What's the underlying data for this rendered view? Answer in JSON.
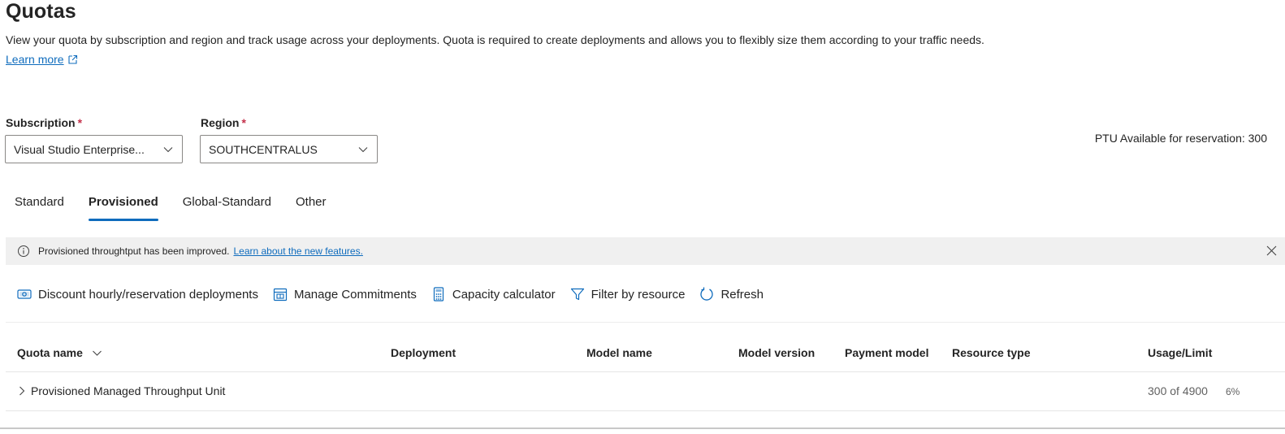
{
  "page": {
    "title": "Quotas",
    "description": "View your quota by subscription and region and track usage across your deployments. Quota is required to create deployments and allows you to flexibly size them according to your traffic needs.",
    "learn_more": "Learn more"
  },
  "filters": {
    "subscription_label": "Subscription",
    "subscription_value": "Visual Studio Enterprise...",
    "region_label": "Region",
    "region_value": "SOUTHCENTRALUS",
    "required_marker": "*"
  },
  "ptu_available": "PTU Available for reservation: 300",
  "tabs": [
    {
      "label": "Standard",
      "active": false
    },
    {
      "label": "Provisioned",
      "active": true
    },
    {
      "label": "Global-Standard",
      "active": false
    },
    {
      "label": "Other",
      "active": false
    }
  ],
  "banner": {
    "text": "Provisioned throughtput has been improved.",
    "link": "Learn about the new features."
  },
  "toolbar": {
    "discount": "Discount hourly/reservation deployments",
    "manage_commitments": "Manage Commitments",
    "capacity_calculator": "Capacity calculator",
    "filter_by_resource": "Filter by resource",
    "refresh": "Refresh"
  },
  "table": {
    "columns": [
      "Quota name",
      "Deployment",
      "Model name",
      "Model version",
      "Payment model",
      "Resource type",
      "Usage/Limit"
    ],
    "rows": [
      {
        "quota_name": "Provisioned Managed Throughput Unit",
        "usage": "300 of 4900",
        "percent": "6%"
      }
    ]
  },
  "colors": {
    "accent": "#0f6cbd",
    "required": "#c4314b",
    "banner_bg": "#f0f0f0"
  }
}
